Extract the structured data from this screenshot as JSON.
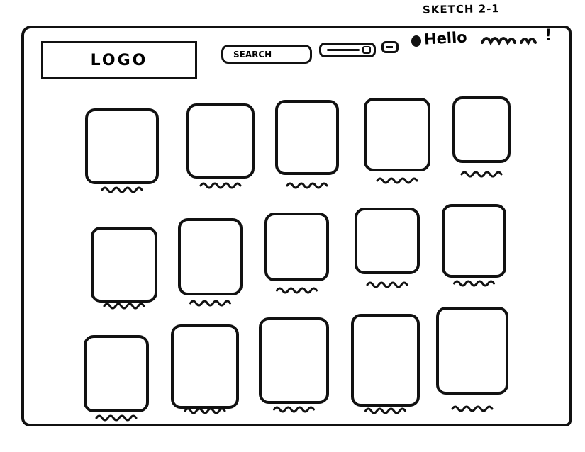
{
  "sketch_title": "SKETCH 2-1",
  "header": {
    "logo": "LOGO",
    "search_label": "SEARCH",
    "greeting": "Hello",
    "greeting_end": "!"
  },
  "grid": {
    "rows": 3,
    "columns": 5
  }
}
